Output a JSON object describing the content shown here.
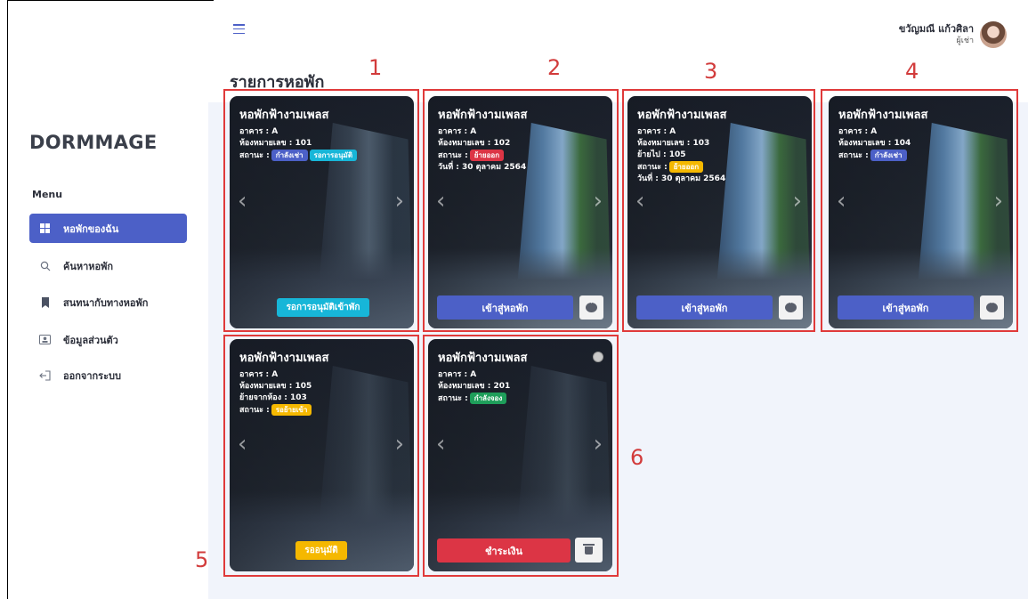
{
  "topbar": {
    "user_name": "ขวัญมณี แก้วศิลา",
    "user_role": "ผู้เช่า"
  },
  "sidebar": {
    "brand": "DORMMAGE",
    "menu_title": "Menu",
    "items": [
      {
        "label": "หอพักของฉัน",
        "icon": "grid-icon",
        "active": true
      },
      {
        "label": "ค้นหาหอพัก",
        "icon": "search-icon",
        "active": false
      },
      {
        "label": "สนทนากับทางหอพัก",
        "icon": "bookmark-icon",
        "active": false
      },
      {
        "label": "ข้อมูลส่วนตัว",
        "icon": "id-card-icon",
        "active": false
      },
      {
        "label": "ออกจากระบบ",
        "icon": "logout-icon",
        "active": false
      }
    ]
  },
  "main": {
    "page_title": "รายการหอพัก"
  },
  "annotations": [
    "1",
    "2",
    "3",
    "4",
    "5",
    "6"
  ],
  "cards": [
    {
      "name": "หอพักฟ้างามเพลส",
      "lines": [
        "อาคาร : A",
        "ห้องหมายเลข : 101"
      ],
      "status_label": "สถานะ :",
      "pills": [
        {
          "text": "กำลังเช่า",
          "color": "#4c60c7"
        },
        {
          "text": "รอการอนุมัติ",
          "color": "#17b6d8"
        }
      ],
      "extra_line": "",
      "action": "รอการอนุมัติเข้าพัก",
      "action_color": "#17b6d8"
    },
    {
      "name": "หอพักฟ้างามเพลส",
      "lines": [
        "อาคาร : A",
        "ห้องหมายเลข : 102"
      ],
      "status_label": "สถานะ :",
      "pills": [
        {
          "text": "ย้ายออก",
          "color": "#dc3545"
        }
      ],
      "extra_line": "วันที่ : 30 ตุลาคม 2564",
      "action": "เข้าสู่หอพัก"
    },
    {
      "name": "หอพักฟ้างามเพลส",
      "lines": [
        "อาคาร : A",
        "ห้องหมายเลข : 103",
        "ย้ายไป : 105"
      ],
      "status_label": "สถานะ :",
      "pills": [
        {
          "text": "ย้ายออก",
          "color": "#f5b800"
        }
      ],
      "extra_line": "วันที่ : 30 ตุลาคม 2564",
      "action": "เข้าสู่หอพัก"
    },
    {
      "name": "หอพักฟ้างามเพลส",
      "lines": [
        "อาคาร : A",
        "ห้องหมายเลข : 104"
      ],
      "status_label": "สถานะ :",
      "pills": [
        {
          "text": "กำลังเช่า",
          "color": "#4c60c7"
        }
      ],
      "extra_line": "",
      "action": "เข้าสู่หอพัก"
    },
    {
      "name": "หอพักฟ้างามเพลส",
      "lines": [
        "อาคาร : A",
        "ห้องหมายเลข : 105",
        "ย้ายจากห้อง : 103"
      ],
      "status_label": "สถานะ :",
      "pills": [
        {
          "text": "รอย้ายเข้า",
          "color": "#f5b800"
        }
      ],
      "extra_line": "",
      "action": "รออนุมัติ",
      "action_color": "#f5b800"
    },
    {
      "name": "หอพักฟ้างามเพลส",
      "lines": [
        "อาคาร : A",
        "ห้องหมายเลข : 201"
      ],
      "status_label": "สถานะ :",
      "pills": [
        {
          "text": "กำลังจอง",
          "color": "#1e9e5a"
        }
      ],
      "extra_line": "",
      "action": "ชำระเงิน"
    }
  ]
}
